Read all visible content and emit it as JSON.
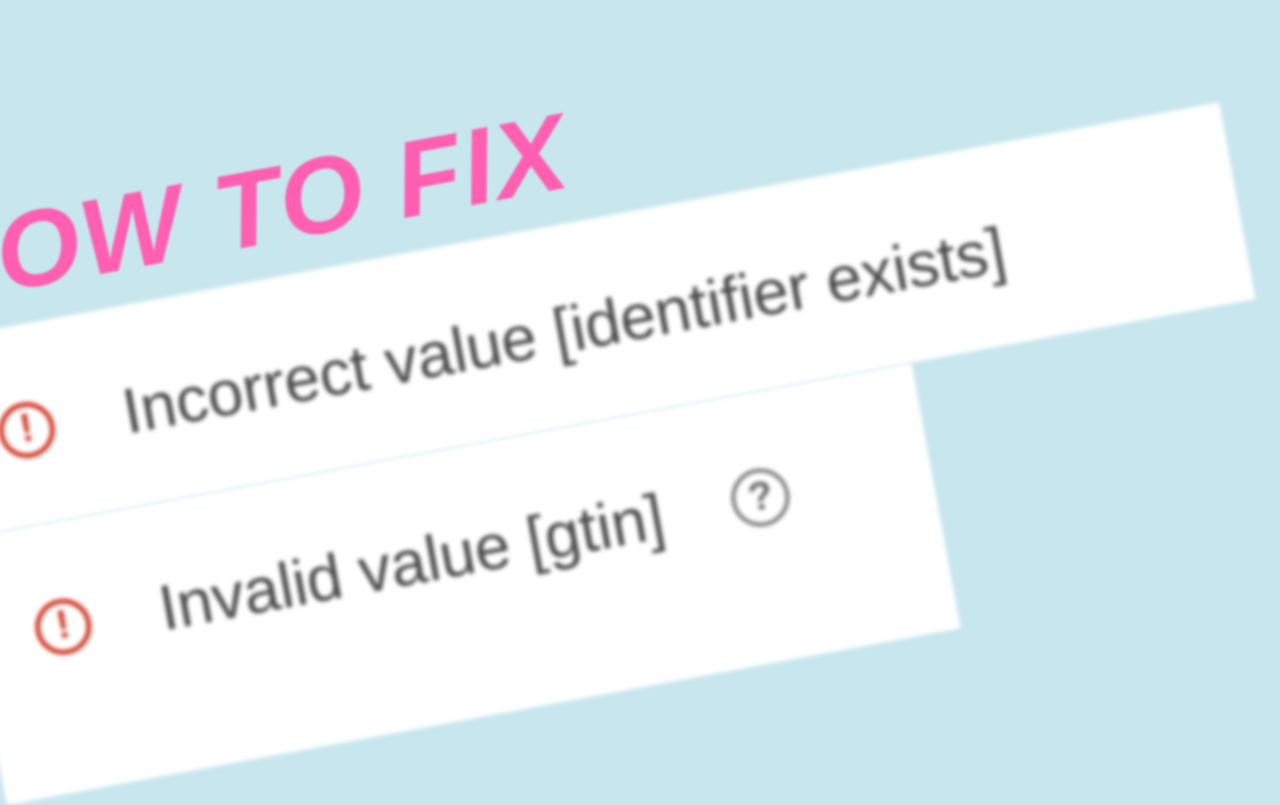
{
  "headline": "HOW TO FIX",
  "errors": [
    {
      "message": "Incorrect value [identifier exists]",
      "help": false
    },
    {
      "message": "Invalid value [gtin]",
      "help": true
    }
  ],
  "colors": {
    "background": "#c7e6ed",
    "headline": "#ff5fb1",
    "alert": "#d23c2a",
    "text": "#4a4a4a",
    "panel": "#ffffff"
  }
}
